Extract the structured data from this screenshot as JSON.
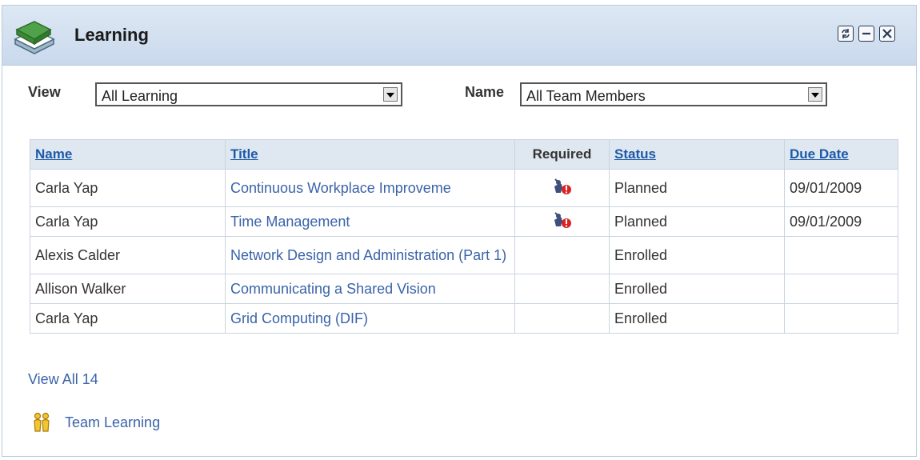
{
  "pagelet": {
    "title": "Learning",
    "buttons": {
      "refresh": "refresh",
      "minimize": "minimize",
      "close": "close"
    }
  },
  "filters": {
    "view_label": "View",
    "view_value": "All Learning",
    "name_label": "Name",
    "name_value": "All Team Members"
  },
  "table": {
    "headers": [
      "Name",
      "Title",
      "Required",
      "Status",
      "Due Date"
    ],
    "rows": [
      {
        "name": "Carla Yap",
        "title": "Continuous Workplace Improveme",
        "required": true,
        "status": "Planned",
        "due": "09/01/2009"
      },
      {
        "name": "Carla Yap",
        "title": "Time Management",
        "required": true,
        "status": "Planned",
        "due": "09/01/2009"
      },
      {
        "name": "Alexis Calder",
        "title": "Network Design and Administration (Part 1)",
        "required": false,
        "status": "Enrolled",
        "due": ""
      },
      {
        "name": "Allison Walker",
        "title": "Communicating a Shared Vision",
        "required": false,
        "status": "Enrolled",
        "due": ""
      },
      {
        "name": "Carla Yap",
        "title": "Grid Computing (DIF)",
        "required": false,
        "status": "Enrolled",
        "due": ""
      }
    ]
  },
  "links": {
    "view_all": "View All 14",
    "team_learning": "Team Learning"
  },
  "icons": {
    "header": "books-icon",
    "required": "required-icon",
    "team": "team-icon"
  },
  "colors": {
    "link": "#3a63a8",
    "header_bg": "#c9d9ec"
  }
}
